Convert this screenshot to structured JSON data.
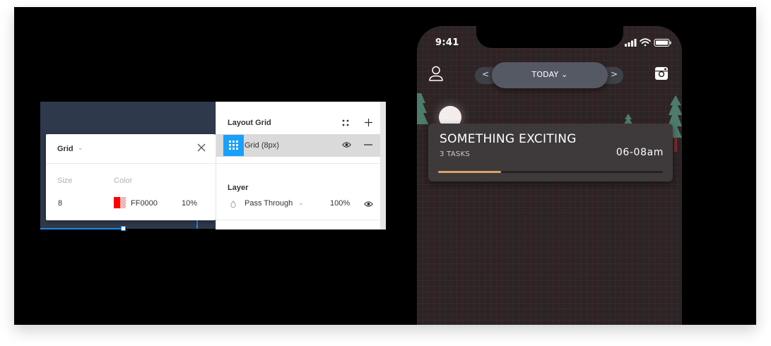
{
  "grid_popover": {
    "title": "Grid",
    "size_label": "Size",
    "color_label": "Color",
    "size_value": "8",
    "color_hex": "FF0000",
    "opacity": "10%",
    "swatch_color": "#ff0000"
  },
  "layout_panel": {
    "layout_grid_title": "Layout Grid",
    "grid_item_label": "Grid (8px)",
    "layer_title": "Layer",
    "blend_mode": "Pass Through",
    "layer_opacity": "100%",
    "accent_color": "#18a0fb"
  },
  "phone": {
    "time": "9:41",
    "date_label": "TODAY",
    "prev_label": "<",
    "next_label": ">",
    "card": {
      "title": "SOMETHING EXCITING",
      "tasks": "3 TASKS",
      "time_range": "06-08am",
      "progress": 0.28,
      "progress_color": "#d7a366"
    },
    "icons": [
      "user-icon",
      "instagram-icon",
      "signal-icon",
      "wifi-icon",
      "battery-icon"
    ]
  }
}
